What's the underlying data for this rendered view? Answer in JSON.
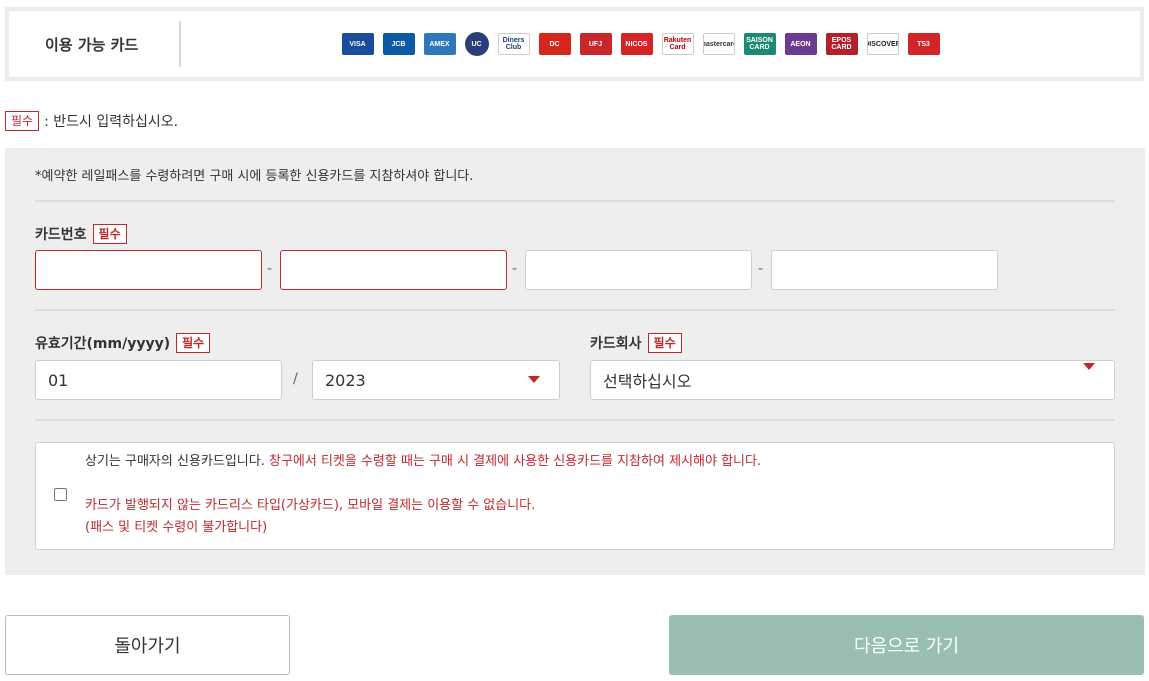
{
  "cards_bar": {
    "title": "이용 가능 카드",
    "logos": [
      {
        "name": "visa",
        "text": "VISA",
        "bg": "#1a4c9c",
        "fg": "#ffffff"
      },
      {
        "name": "jcb",
        "text": "JCB",
        "bg": "#0c5aa6",
        "fg": "#ffffff"
      },
      {
        "name": "amex",
        "text": "AMEX",
        "bg": "#2e77bb",
        "fg": "#ffffff"
      },
      {
        "name": "uc",
        "text": "UC",
        "bg": "#2a3f7a",
        "fg": "#ffffff"
      },
      {
        "name": "diners-club",
        "text": "Diners Club",
        "bg": "#ffffff",
        "fg": "#1c3f7a"
      },
      {
        "name": "dc",
        "text": "DC",
        "bg": "#d7261c",
        "fg": "#ffffff"
      },
      {
        "name": "ufj",
        "text": "UFJ",
        "bg": "#c8262b",
        "fg": "#ffffff"
      },
      {
        "name": "nicos",
        "text": "NICOS",
        "bg": "#d42425",
        "fg": "#ffffff"
      },
      {
        "name": "rakuten",
        "text": "Rakuten Card",
        "bg": "#ffffff",
        "fg": "#bf0000"
      },
      {
        "name": "mastercard",
        "text": "mastercard",
        "bg": "#ffffff",
        "fg": "#333333"
      },
      {
        "name": "saison",
        "text": "SAISON CARD",
        "bg": "#1a8a73",
        "fg": "#ffffff"
      },
      {
        "name": "aeon",
        "text": "AEON",
        "bg": "#6c3b8f",
        "fg": "#ffffff"
      },
      {
        "name": "epos",
        "text": "EPOS CARD",
        "bg": "#b3202a",
        "fg": "#ffffff"
      },
      {
        "name": "discover",
        "text": "DISCOVER",
        "bg": "#ffffff",
        "fg": "#222222"
      },
      {
        "name": "ts3",
        "text": "TS3",
        "bg": "#d42428",
        "fg": "#ffffff"
      }
    ]
  },
  "required_note": {
    "badge": "필수",
    "text": ": 반드시 입력하십시오."
  },
  "form": {
    "notice": "*예약한 레일패스를 수령하려면 구매 시에 등록한 신용카드를 지참하셔야 합니다.",
    "card_number": {
      "label": "카드번호",
      "badge": "필수",
      "fields": [
        "",
        "",
        "",
        ""
      ],
      "separator": "-"
    },
    "expiry": {
      "label": "유효기간(mm/yyyy)",
      "badge": "필수",
      "month": "01",
      "separator": "/",
      "year": "2023"
    },
    "card_company": {
      "label": "카드회사",
      "badge": "필수",
      "selected": "선택하십시오"
    },
    "agreement": {
      "line1_dark": "상기는 구매자의 신용카드입니다.",
      "line1_red": "창구에서 티켓을 수령할 때는 구매 시 결제에 사용한 신용카드를 지참하여 제시해야 합니다.",
      "line2": "카드가 발행되지 않는 카드리스 타입(가상카드), 모바일 결제는 이용할 수 없습니다.",
      "line3": "(패스 및 티켓 수령이 불가합니다)"
    }
  },
  "buttons": {
    "back": "돌아가기",
    "next": "다음으로 가기"
  },
  "colors": {
    "accent_red": "#c0282d",
    "next_button": "#98bfb1",
    "panel_bg": "#eeeeee"
  }
}
